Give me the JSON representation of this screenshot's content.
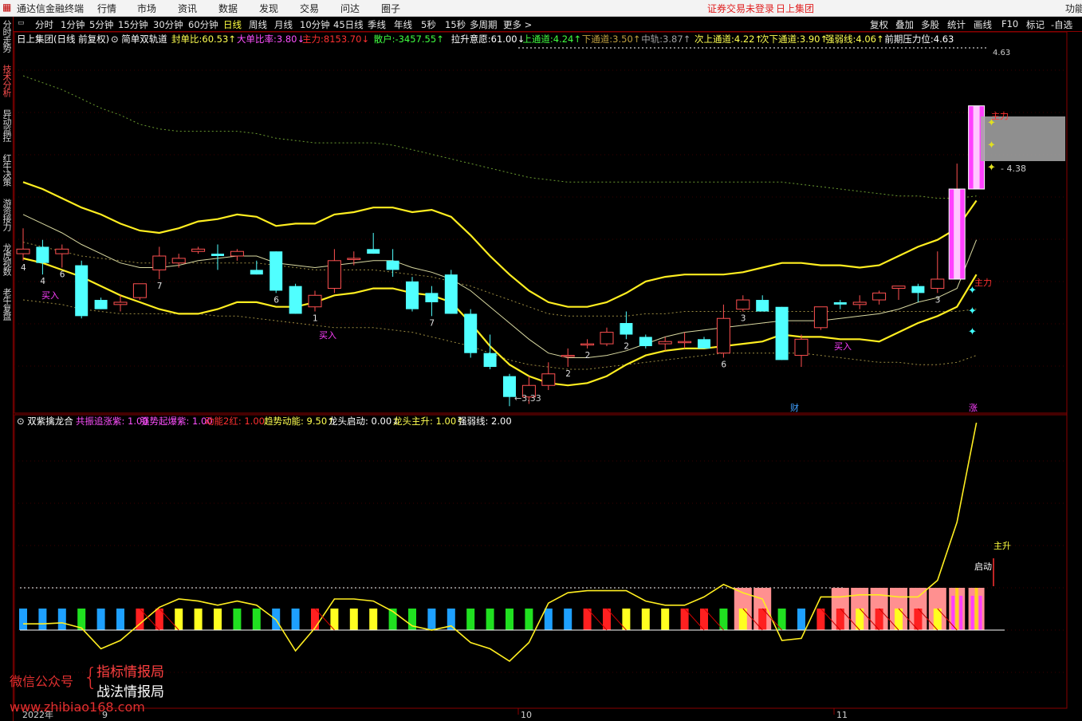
{
  "app": {
    "title": "通达信金融终端",
    "menu": [
      "行情",
      "市场",
      "资讯",
      "数据",
      "发现",
      "交易",
      "问达",
      "圈子"
    ],
    "login_status": "证券交易未登录",
    "stock_name": "日上集团",
    "right_cut": "功能"
  },
  "period_tabs": [
    "分时",
    "1分钟",
    "5分钟",
    "15分钟",
    "30分钟",
    "60分钟",
    "日线",
    "周线",
    "月线",
    "10分钟",
    "45日线",
    "季线",
    "年线",
    "5秒",
    "15秒",
    "多周期",
    "更多 >"
  ],
  "active_period": "日线",
  "right_tools": [
    "复权",
    "叠加",
    "多股",
    "统计",
    "画线",
    "F10",
    "标记",
    "-自选"
  ],
  "side_tabs": [
    "分时走势",
    "技术分析",
    "异动监控",
    "红牛决策",
    "游资接力",
    "龙虎视数",
    "老牛复盘"
  ],
  "active_side_tab": "技术分析",
  "main_header": {
    "stock": "日上集团(日线 前复权)",
    "indicator": "简单双轨道",
    "items": [
      {
        "label": "封单比:",
        "value": "60.53",
        "arrow": "↑",
        "color": "#ffff50"
      },
      {
        "label": "大单比率:",
        "value": "3.80",
        "arrow": "↓",
        "color": "#ff50ff"
      },
      {
        "label": "主力:",
        "value": "8153.70",
        "arrow": "↓",
        "color": "#ff3030"
      },
      {
        "label": "散户:",
        "value": "-3457.55",
        "arrow": "↑",
        "color": "#40ff40"
      },
      {
        "label": "拉升意愿:",
        "value": "61.00",
        "arrow": "↓",
        "color": "#ffffff"
      },
      {
        "label": "上通道:",
        "value": "4.24",
        "arrow": "↑",
        "color": "#40ff40"
      },
      {
        "label": "下通道:",
        "value": "3.50",
        "arrow": "↑",
        "color": "#c0a040"
      },
      {
        "label": "中轨:",
        "value": "3.87",
        "arrow": "↑",
        "color": "#a0a0a0"
      },
      {
        "label": "次上通道:",
        "value": "4.22",
        "arrow": "↑",
        "color": "#ffff50"
      },
      {
        "label": "次下通道:",
        "value": "3.90",
        "arrow": "↑",
        "color": "#ffff50"
      },
      {
        "label": "强弱线:",
        "value": "4.06",
        "arrow": "↑",
        "color": "#ffff50"
      },
      {
        "label": "前期压力位:",
        "value": "4.63",
        "arrow": "",
        "color": "#ffffff"
      }
    ]
  },
  "sub_header": {
    "indicator": "双紫擒龙合",
    "items": [
      {
        "label": "共振追涨紫:",
        "value": "1.00",
        "color": "#ff50ff"
      },
      {
        "label": "强势起爆紫:",
        "value": "1.00",
        "color": "#ff50ff"
      },
      {
        "label": "动能2红:",
        "value": "1.00",
        "color": "#ff3030"
      },
      {
        "label": "趋势动能:",
        "value": "9.50",
        "arrow": "↑",
        "color": "#ffff50"
      },
      {
        "label": "龙头启动:",
        "value": "0.00",
        "arrow": "↓",
        "color": "#ffffff"
      },
      {
        "label": "龙头主升:",
        "value": "1.00",
        "arrow": "↑",
        "color": "#ffff50"
      },
      {
        "label": "强弱线:",
        "value": "2.00",
        "color": "#ffffff"
      }
    ]
  },
  "price_annotations": {
    "low_label": "3.33",
    "high_label": "4.38",
    "top_label": "4.63"
  },
  "chart_labels": {
    "buy": "买入",
    "main_force": "主力",
    "start": "启动",
    "main_rise": "主升",
    "fin_marker": "财",
    "rise_marker": "涨"
  },
  "x_axis": {
    "year": "2022年",
    "months": [
      "9",
      "10",
      "11"
    ]
  },
  "watermark": {
    "wechat": "微信公众号",
    "line1": "指标情报局",
    "line2": "战法情报局",
    "site": "www.zhibiao168.com"
  },
  "chart_data": {
    "type": "candlestick",
    "candles": [
      {
        "o": 3.99,
        "h": 4.1,
        "l": 3.96,
        "c": 4.01,
        "num": "4"
      },
      {
        "o": 4.02,
        "h": 4.05,
        "l": 3.9,
        "c": 3.95,
        "num": "4"
      },
      {
        "o": 3.99,
        "h": 4.03,
        "l": 3.93,
        "c": 4.01,
        "num": "6"
      },
      {
        "o": 3.94,
        "h": 3.96,
        "l": 3.71,
        "c": 3.72
      },
      {
        "o": 3.79,
        "h": 3.8,
        "l": 3.75,
        "c": 3.75
      },
      {
        "o": 3.77,
        "h": 3.81,
        "l": 3.74,
        "c": 3.78
      },
      {
        "o": 3.8,
        "h": 3.86,
        "l": 3.79,
        "c": 3.86
      },
      {
        "o": 3.92,
        "h": 4.02,
        "l": 3.88,
        "c": 3.98,
        "num": "7"
      },
      {
        "o": 3.95,
        "h": 3.99,
        "l": 3.93,
        "c": 3.97
      },
      {
        "o": 4.0,
        "h": 4.02,
        "l": 3.99,
        "c": 4.01
      },
      {
        "o": 3.99,
        "h": 4.03,
        "l": 3.92,
        "c": 3.98
      },
      {
        "o": 3.98,
        "h": 4.01,
        "l": 3.96,
        "c": 4.0
      },
      {
        "o": 3.92,
        "h": 3.96,
        "l": 3.9,
        "c": 3.9
      },
      {
        "o": 4.0,
        "h": 4.0,
        "l": 3.82,
        "c": 3.83,
        "num": "6"
      },
      {
        "o": 3.85,
        "h": 3.86,
        "l": 3.73,
        "c": 3.73
      },
      {
        "o": 3.76,
        "h": 3.83,
        "l": 3.74,
        "c": 3.81,
        "num": "1"
      },
      {
        "o": 3.84,
        "h": 4.01,
        "l": 3.82,
        "c": 3.96
      },
      {
        "o": 3.97,
        "h": 4.0,
        "l": 3.94,
        "c": 3.97
      },
      {
        "o": 4.01,
        "h": 4.08,
        "l": 3.99,
        "c": 3.99
      },
      {
        "o": 3.96,
        "h": 4.01,
        "l": 3.89,
        "c": 3.92
      },
      {
        "o": 3.87,
        "h": 3.89,
        "l": 3.74,
        "c": 3.75
      },
      {
        "o": 3.82,
        "h": 3.85,
        "l": 3.72,
        "c": 3.78,
        "num": "7"
      },
      {
        "o": 3.9,
        "h": 3.92,
        "l": 3.73,
        "c": 3.73
      },
      {
        "o": 3.73,
        "h": 3.75,
        "l": 3.54,
        "c": 3.56
      },
      {
        "o": 3.56,
        "h": 3.64,
        "l": 3.49,
        "c": 3.5
      },
      {
        "o": 3.46,
        "h": 3.47,
        "l": 3.33,
        "c": 3.37
      },
      {
        "o": 3.37,
        "h": 3.46,
        "l": 3.34,
        "c": 3.42
      },
      {
        "o": 3.42,
        "h": 3.52,
        "l": 3.4,
        "c": 3.47
      },
      {
        "o": 3.55,
        "h": 3.58,
        "l": 3.5,
        "c": 3.55,
        "num": "2"
      },
      {
        "o": 3.6,
        "h": 3.62,
        "l": 3.58,
        "c": 3.6,
        "num": "2"
      },
      {
        "o": 3.6,
        "h": 3.67,
        "l": 3.59,
        "c": 3.65
      },
      {
        "o": 3.69,
        "h": 3.74,
        "l": 3.62,
        "c": 3.64,
        "num": "2"
      },
      {
        "o": 3.63,
        "h": 3.64,
        "l": 3.58,
        "c": 3.59
      },
      {
        "o": 3.6,
        "h": 3.63,
        "l": 3.57,
        "c": 3.61
      },
      {
        "o": 3.61,
        "h": 3.65,
        "l": 3.58,
        "c": 3.61
      },
      {
        "o": 3.62,
        "h": 3.63,
        "l": 3.58,
        "c": 3.58
      },
      {
        "o": 3.56,
        "h": 3.77,
        "l": 3.54,
        "c": 3.71,
        "num": "6"
      },
      {
        "o": 3.75,
        "h": 3.81,
        "l": 3.74,
        "c": 3.79,
        "num": "3"
      },
      {
        "o": 3.79,
        "h": 3.81,
        "l": 3.74,
        "c": 3.74
      },
      {
        "o": 3.76,
        "h": 3.76,
        "l": 3.53,
        "c": 3.53
      },
      {
        "o": 3.55,
        "h": 3.64,
        "l": 3.5,
        "c": 3.62
      },
      {
        "o": 3.67,
        "h": 3.76,
        "l": 3.66,
        "c": 3.76
      },
      {
        "o": 3.78,
        "h": 3.79,
        "l": 3.75,
        "c": 3.77
      },
      {
        "o": 3.77,
        "h": 3.81,
        "l": 3.75,
        "c": 3.78
      },
      {
        "o": 3.79,
        "h": 3.83,
        "l": 3.77,
        "c": 3.82
      },
      {
        "o": 3.84,
        "h": 3.85,
        "l": 3.79,
        "c": 3.85
      },
      {
        "o": 3.85,
        "h": 3.86,
        "l": 3.78,
        "c": 3.82
      },
      {
        "o": 3.84,
        "h": 4.0,
        "l": 3.82,
        "c": 3.88,
        "num": "3"
      },
      {
        "o": 3.88,
        "h": 4.38,
        "l": 3.88,
        "c": 4.27
      },
      {
        "o": 4.27,
        "h": 4.63,
        "l": 4.27,
        "c": 4.63
      }
    ],
    "upper_channel": [
      4.3,
      4.27,
      4.23,
      4.19,
      4.16,
      4.12,
      4.09,
      4.08,
      4.1,
      4.13,
      4.14,
      4.16,
      4.15,
      4.11,
      4.12,
      4.12,
      4.16,
      4.17,
      4.19,
      4.19,
      4.17,
      4.18,
      4.15,
      4.07,
      3.98,
      3.9,
      3.83,
      3.78,
      3.76,
      3.76,
      3.78,
      3.82,
      3.87,
      3.89,
      3.9,
      3.9,
      3.9,
      3.91,
      3.93,
      3.95,
      3.95,
      3.94,
      3.94,
      3.93,
      3.94,
      3.98,
      4.02,
      4.05,
      4.1,
      4.22
    ],
    "lower_channel": [
      3.97,
      3.95,
      3.92,
      3.89,
      3.85,
      3.81,
      3.78,
      3.75,
      3.73,
      3.73,
      3.75,
      3.78,
      3.78,
      3.76,
      3.76,
      3.78,
      3.81,
      3.82,
      3.84,
      3.84,
      3.82,
      3.81,
      3.78,
      3.69,
      3.59,
      3.51,
      3.46,
      3.43,
      3.42,
      3.43,
      3.46,
      3.51,
      3.55,
      3.57,
      3.58,
      3.58,
      3.59,
      3.6,
      3.61,
      3.64,
      3.63,
      3.63,
      3.62,
      3.62,
      3.61,
      3.65,
      3.69,
      3.72,
      3.76,
      3.9
    ],
    "mid_line": [
      4.16,
      4.12,
      4.08,
      4.03,
      3.99,
      3.95,
      3.93,
      3.93,
      3.94,
      3.96,
      3.97,
      3.98,
      3.98,
      3.95,
      3.94,
      3.93,
      3.94,
      3.95,
      3.96,
      3.96,
      3.93,
      3.91,
      3.88,
      3.83,
      3.76,
      3.69,
      3.62,
      3.56,
      3.54,
      3.54,
      3.55,
      3.57,
      3.6,
      3.63,
      3.65,
      3.66,
      3.67,
      3.68,
      3.69,
      3.7,
      3.7,
      3.7,
      3.71,
      3.72,
      3.73,
      3.75,
      3.78,
      3.8,
      3.84,
      4.05
    ],
    "upper_dotted": [
      4.76,
      4.73,
      4.7,
      4.66,
      4.62,
      4.59,
      4.55,
      4.53,
      4.52,
      4.52,
      4.52,
      4.52,
      4.51,
      4.49,
      4.48,
      4.47,
      4.47,
      4.47,
      4.47,
      4.46,
      4.44,
      4.42,
      4.4,
      4.38,
      4.36,
      4.34,
      4.32,
      4.31,
      4.3,
      4.3,
      4.3,
      4.3,
      4.3,
      4.3,
      4.3,
      4.3,
      4.3,
      4.3,
      4.3,
      4.3,
      4.29,
      4.28,
      4.27,
      4.26,
      4.25,
      4.24,
      4.24,
      4.23,
      4.23,
      4.24
    ],
    "mid_dotted": [
      4.04,
      4.02,
      4.0,
      3.98,
      3.97,
      3.96,
      3.95,
      3.95,
      3.95,
      3.95,
      3.95,
      3.95,
      3.95,
      3.94,
      3.93,
      3.92,
      3.92,
      3.92,
      3.92,
      3.91,
      3.9,
      3.89,
      3.87,
      3.85,
      3.82,
      3.79,
      3.76,
      3.73,
      3.72,
      3.72,
      3.72,
      3.72,
      3.73,
      3.73,
      3.74,
      3.74,
      3.74,
      3.74,
      3.74,
      3.74,
      3.74,
      3.74,
      3.74,
      3.74,
      3.74,
      3.74,
      3.74,
      3.74,
      3.74,
      3.75
    ],
    "lower_dotted": [
      3.79,
      3.78,
      3.77,
      3.75,
      3.74,
      3.73,
      3.73,
      3.73,
      3.73,
      3.73,
      3.72,
      3.72,
      3.71,
      3.7,
      3.69,
      3.68,
      3.67,
      3.67,
      3.67,
      3.66,
      3.65,
      3.63,
      3.61,
      3.59,
      3.56,
      3.53,
      3.51,
      3.5,
      3.49,
      3.49,
      3.5,
      3.51,
      3.52,
      3.53,
      3.54,
      3.55,
      3.56,
      3.56,
      3.56,
      3.56,
      3.56,
      3.55,
      3.54,
      3.53,
      3.52,
      3.52,
      3.51,
      3.51,
      3.52,
      3.55
    ],
    "sub_line": [
      0.3,
      0.3,
      0.35,
      0.1,
      -0.9,
      -0.5,
      0.3,
      1.1,
      1.5,
      1.4,
      1.2,
      1.4,
      1.2,
      0.5,
      -1.0,
      0.1,
      1.5,
      1.5,
      1.4,
      0.9,
      0.2,
      0.0,
      0.2,
      -0.6,
      -0.9,
      -1.5,
      -0.6,
      1.3,
      1.8,
      1.9,
      1.9,
      1.9,
      1.4,
      1.2,
      1.2,
      1.6,
      2.2,
      1.8,
      1.5,
      -0.5,
      -0.4,
      1.6,
      1.6,
      1.7,
      1.7,
      1.6,
      1.6,
      2.4,
      5.2,
      10.0
    ],
    "sub_bar_colors": [
      "blue",
      "blue",
      "blue",
      "green",
      "blue",
      "blue",
      "red",
      "red",
      "yellow",
      "yellow",
      "yellow",
      "green",
      "green",
      "blue",
      "blue",
      "red",
      "yellow",
      "yellow",
      "yellow",
      "green",
      "green",
      "blue",
      "blue",
      "green",
      "green",
      "green",
      "green",
      "blue",
      "blue",
      "red",
      "red",
      "yellow",
      "yellow",
      "yellow",
      "red",
      "red",
      "green",
      "pink",
      "pink",
      "green",
      "blue",
      "red",
      "pink",
      "pink",
      "pink",
      "pink",
      "pink",
      "pink",
      "multi",
      "multi"
    ]
  }
}
